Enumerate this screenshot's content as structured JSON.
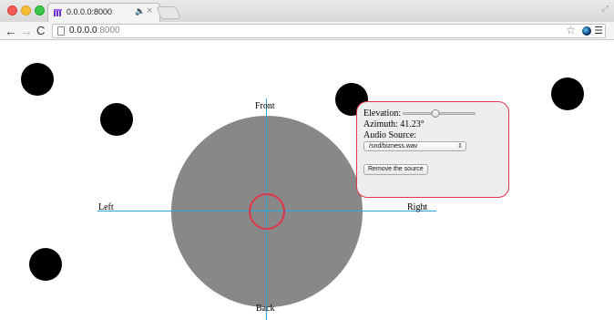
{
  "browser": {
    "tab_title": "0.0.0.0:8000",
    "tab_audio_icon": "speaker-icon",
    "tab_close_icon": "close-icon",
    "url_host": "0.0.0.0",
    "url_port": ":8000"
  },
  "panner": {
    "labels": {
      "front": "Front",
      "left": "Left",
      "right": "Right",
      "back": "Back"
    },
    "panel": {
      "elevation_label": "Elevation:",
      "elevation_value": 0.45,
      "azimuth_text": "Azimuth: 41.23°",
      "audio_source_label": "Audio Source:",
      "audio_source_value": "/snd/bizness.wav",
      "remove_button": "Remove the source"
    }
  },
  "colors": {
    "accent_red": "#e0364a",
    "axis_blue": "#2aa6e0",
    "listener_gray": "#888888"
  }
}
